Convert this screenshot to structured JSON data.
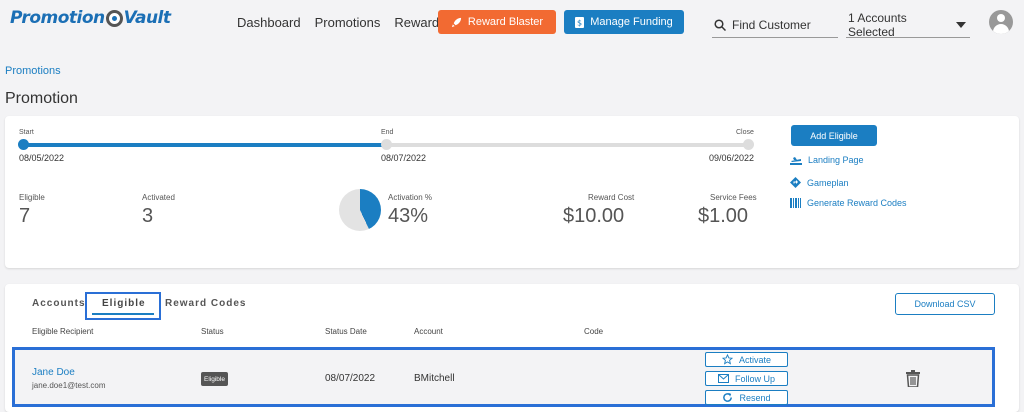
{
  "brand": {
    "logo_left": "Promotion",
    "logo_right": "Vault"
  },
  "nav": {
    "links": [
      "Dashboard",
      "Promotions",
      "Rewards"
    ],
    "reward_blaster_label": "Reward Blaster",
    "manage_funding_label": "Manage Funding",
    "search_placeholder": "Find Customer",
    "accounts_selected": "1 Accounts Selected"
  },
  "breadcrumb": "Promotions",
  "page_title": "Promotion",
  "timeline": {
    "start_label": "Start",
    "start_date": "08/05/2022",
    "end_label": "End",
    "end_date": "08/07/2022",
    "close_label": "Close",
    "close_date": "09/06/2022",
    "progress": 0.5
  },
  "stats": {
    "eligible_label": "Eligible",
    "eligible_value": "7",
    "activated_label": "Activated",
    "activated_value": "3",
    "activation_label": "Activation %",
    "activation_value": "43%",
    "reward_cost_label": "Reward Cost",
    "reward_cost_value": "$10.00",
    "service_fees_label": "Service Fees",
    "service_fees_value": "$1.00"
  },
  "actions": {
    "add_eligible": "Add Eligible",
    "landing_page": "Landing Page",
    "gameplan": "Gameplan",
    "generate_codes": "Generate Reward Codes"
  },
  "tabs": {
    "accounts": "Accounts",
    "eligible": "Eligible",
    "reward_codes": "Reward Codes"
  },
  "download_csv": "Download CSV",
  "table": {
    "headers": {
      "recipient": "Eligible Recipient",
      "status": "Status",
      "status_date": "Status Date",
      "account": "Account",
      "code": "Code"
    },
    "rows": [
      {
        "name": "Jane Doe",
        "email": "jane.doe1@test.com",
        "status": "Eligible",
        "status_date": "08/07/2022",
        "account": "BMitchell",
        "code": "",
        "activate": "Activate",
        "follow_up": "Follow Up",
        "resend": "Resend"
      }
    ]
  },
  "colors": {
    "primary": "#1b7ec2",
    "orange": "#f26a32",
    "highlight": "#2a6fd6"
  },
  "icons": [
    "rocket-icon",
    "dollar-document-icon",
    "search-icon",
    "chevron-down-icon",
    "user-avatar-icon",
    "plane-icon",
    "diamond-arrow-icon",
    "barcode-icon",
    "star-icon",
    "envelope-icon",
    "refresh-icon",
    "trash-icon"
  ]
}
